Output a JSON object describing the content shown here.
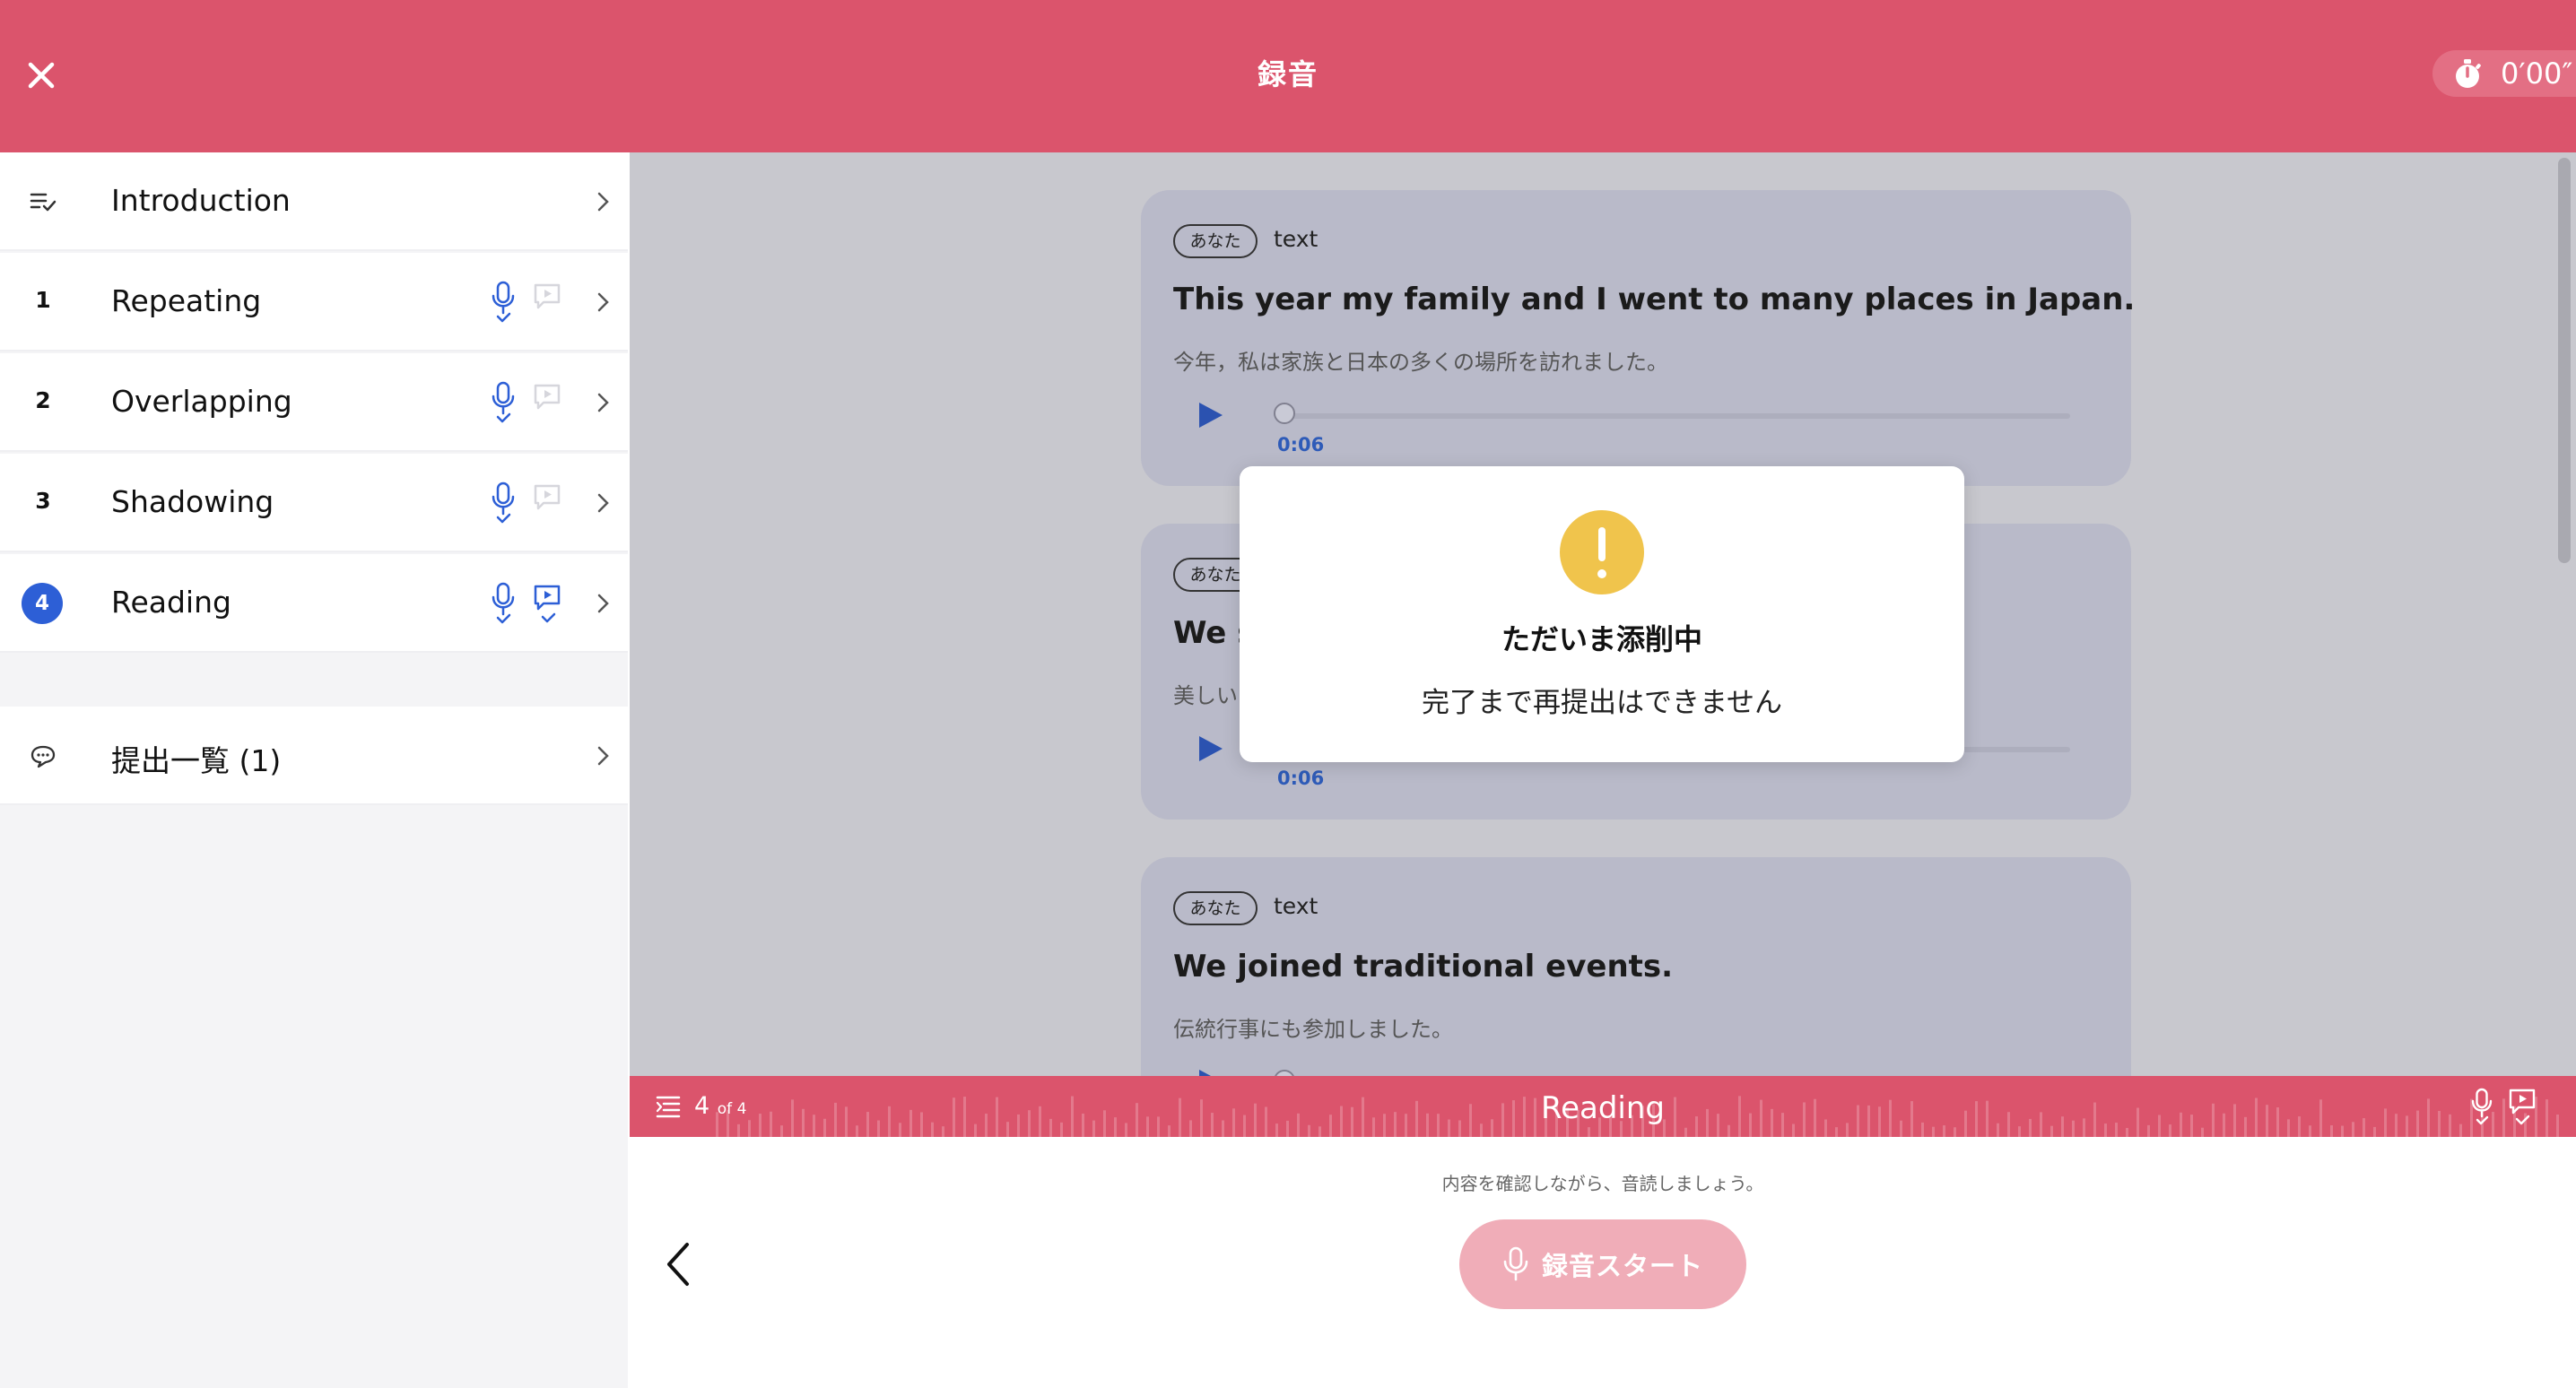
{
  "header": {
    "title": "録音",
    "timer": "0′00″"
  },
  "sidebar": {
    "items": [
      {
        "num": "",
        "label": "Introduction"
      },
      {
        "num": "1",
        "label": "Repeating"
      },
      {
        "num": "2",
        "label": "Overlapping"
      },
      {
        "num": "3",
        "label": "Shadowing"
      },
      {
        "num": "4",
        "label": "Reading"
      }
    ],
    "submissions_label": "提出一覧 (1)"
  },
  "cards": [
    {
      "pill": "あなた",
      "tag": "text",
      "english": "This year my family and I went to many places in Japan.",
      "japanese": "今年，私は家族と日本の多くの場所を訪れました。",
      "duration": "0:06"
    },
    {
      "pill": "あなた",
      "tag": "text",
      "english": "We s",
      "japanese": "美しい",
      "duration": "0:06"
    },
    {
      "pill": "あなた",
      "tag": "text",
      "english": "We joined traditional events.",
      "japanese": "伝統行事にも参加しました。",
      "duration": ""
    }
  ],
  "dialog": {
    "title": "ただいま添削中",
    "message": "完了まで再提出はできません"
  },
  "progress": {
    "current": "4",
    "of_text": "of 4",
    "title": "Reading"
  },
  "bottom": {
    "hint": "内容を確認しながら、音読しましょう。",
    "record_label": "録音スタート"
  },
  "colors": {
    "brand": "#db546c",
    "accent": "#2d5fd6",
    "warning": "#f0c44c"
  },
  "icons": {
    "close": "close-icon",
    "timer": "stopwatch-icon",
    "list": "list-check-icon",
    "mic": "mic-check-icon",
    "bubble": "speech-play-icon",
    "chevron": "chevron-right-icon",
    "comment": "comment-icon",
    "warning": "exclamation-icon",
    "play": "play-icon",
    "back": "chevron-left-icon"
  }
}
